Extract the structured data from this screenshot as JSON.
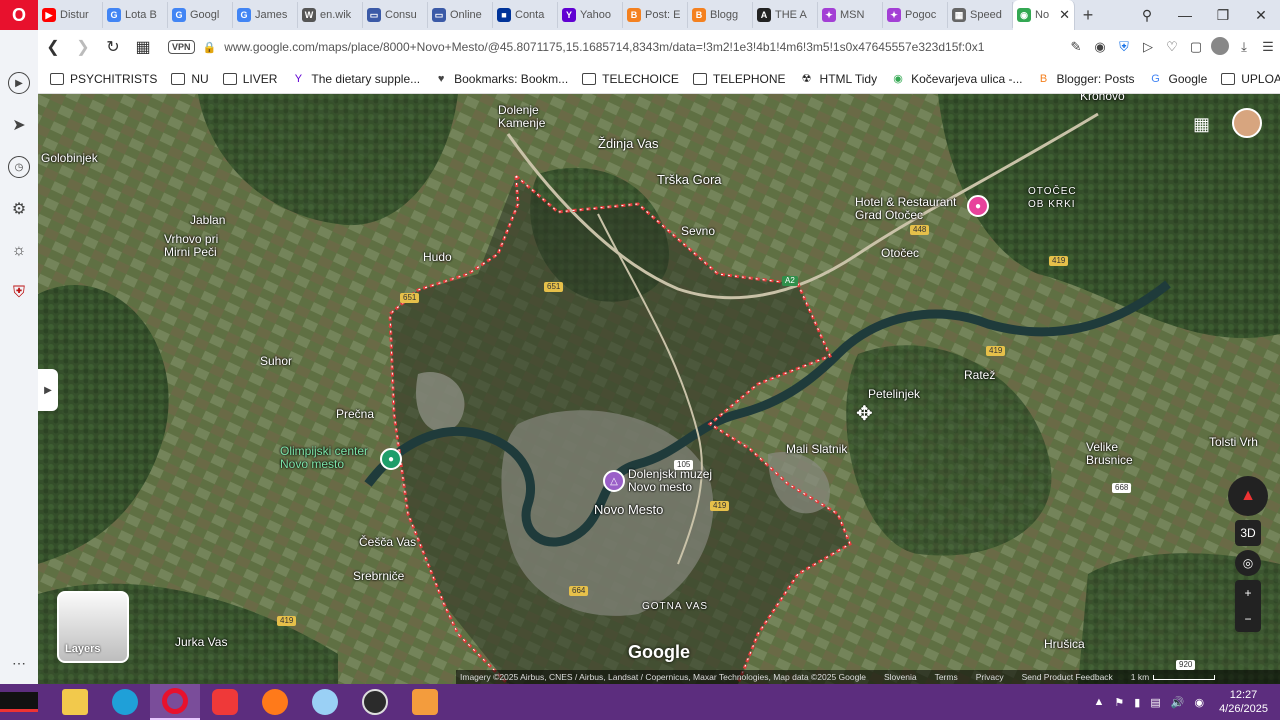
{
  "tabs": [
    {
      "label": "Distur",
      "color": "#ff0000",
      "glyph": "▶"
    },
    {
      "label": "Lota B",
      "color": "#4285f4",
      "glyph": "G"
    },
    {
      "label": "Googl",
      "color": "#4285f4",
      "glyph": "G"
    },
    {
      "label": "James",
      "color": "#4285f4",
      "glyph": "G"
    },
    {
      "label": "en.wik",
      "color": "#555555",
      "glyph": "W"
    },
    {
      "label": "Consu",
      "color": "#3b5aa7",
      "glyph": "▭"
    },
    {
      "label": "Online",
      "color": "#3b5aa7",
      "glyph": "▭"
    },
    {
      "label": "Conta",
      "color": "#003399",
      "glyph": "■"
    },
    {
      "label": "Yahoo",
      "color": "#6001d2",
      "glyph": "Y"
    },
    {
      "label": "Post: E",
      "color": "#f48120",
      "glyph": "B"
    },
    {
      "label": "Blogg",
      "color": "#f48120",
      "glyph": "B"
    },
    {
      "label": "THE A",
      "color": "#222222",
      "glyph": "A"
    },
    {
      "label": "MSN",
      "color": "#a33fd5",
      "glyph": "✦"
    },
    {
      "label": "Pogoc",
      "color": "#a33fd5",
      "glyph": "✦"
    },
    {
      "label": "Speed",
      "color": "#666666",
      "glyph": "▦"
    },
    {
      "label": "No",
      "color": "#34a853",
      "glyph": "◉",
      "active": true
    }
  ],
  "address": {
    "vpn": "VPN",
    "url": "www.google.com/maps/place/8000+Novo+Mesto/@45.8071175,15.1685714,8343m/data=!3m2!1e3!4b1!4m6!3m5!1s0x47645557e323d15f:0x1"
  },
  "bookmarks": [
    {
      "label": "PSYCHITRISTS",
      "icon": "folder"
    },
    {
      "label": "NU",
      "icon": "folder"
    },
    {
      "label": "LIVER",
      "icon": "folder"
    },
    {
      "label": "The dietary supple...",
      "icon": "yahoo"
    },
    {
      "label": "Bookmarks: Bookm...",
      "icon": "heart"
    },
    {
      "label": "TELECHOICE",
      "icon": "folder"
    },
    {
      "label": "TELEPHONE",
      "icon": "folder"
    },
    {
      "label": "HTML Tidy",
      "icon": "tidy"
    },
    {
      "label": "Kočevarjeva ulica -...",
      "icon": "maps"
    },
    {
      "label": "Blogger: Posts",
      "icon": "blogger"
    },
    {
      "label": "Google",
      "icon": "google"
    },
    {
      "label": "UPLOAD",
      "icon": "folder"
    }
  ],
  "map": {
    "places": [
      {
        "name": "Krohovo",
        "cls": ""
      },
      {
        "name": "Dolenje\nKamenje",
        "cls": ""
      },
      {
        "name": "Ždinja Vas",
        "cls": "big"
      },
      {
        "name": "Golobinjek",
        "cls": ""
      },
      {
        "name": "Trška Gora",
        "cls": "big"
      },
      {
        "name": "Hotel & Restaurant\nGrad Otočec",
        "cls": ""
      },
      {
        "name": "OTOČEC\nOB KRKI",
        "cls": "small"
      },
      {
        "name": "Jablan",
        "cls": ""
      },
      {
        "name": "Vrhovo pri\nMirni Peči",
        "cls": ""
      },
      {
        "name": "Sevno",
        "cls": ""
      },
      {
        "name": "Hudo",
        "cls": ""
      },
      {
        "name": "Otočec",
        "cls": ""
      },
      {
        "name": "Suhor",
        "cls": ""
      },
      {
        "name": "Ratež",
        "cls": ""
      },
      {
        "name": "Petelinjek",
        "cls": ""
      },
      {
        "name": "Prečna",
        "cls": ""
      },
      {
        "name": "Olimpijski center\nNovo mesto",
        "cls": "green"
      },
      {
        "name": "Mali Slatnik",
        "cls": ""
      },
      {
        "name": "Velike\nBrusnice",
        "cls": ""
      },
      {
        "name": "Tolsti Vrh",
        "cls": ""
      },
      {
        "name": "Dolenjski muzej\nNovo mesto",
        "cls": ""
      },
      {
        "name": "Novo Mesto",
        "cls": "big"
      },
      {
        "name": "Češča Vas",
        "cls": ""
      },
      {
        "name": "Srebrniče",
        "cls": ""
      },
      {
        "name": "GOTNA VAS",
        "cls": "small"
      },
      {
        "name": "Jurka Vas",
        "cls": ""
      },
      {
        "name": "Hrušica",
        "cls": ""
      }
    ],
    "roads": [
      "448",
      "419",
      "651",
      "651",
      "419",
      "105",
      "419",
      "664",
      "668",
      "419",
      "920",
      "A2"
    ],
    "layers_label": "Layers",
    "watermark": "Google",
    "ctrl_3d": "3D",
    "zoom_in": "+",
    "zoom_out": "−",
    "attribution": [
      "Imagery ©2025 Airbus, CNES / Airbus, Landsat / Copernicus, Maxar Technologies, Map data ©2025 Google",
      "Slovenia",
      "Terms",
      "Privacy",
      "Send Product Feedback"
    ],
    "scale": "1 km"
  },
  "taskbar": {
    "time": "12:27",
    "date": "4/26/2025"
  },
  "colors": {
    "opera_red": "#e8112d",
    "taskbar": "#5c2d7e",
    "boundary": "#e23b3b"
  }
}
